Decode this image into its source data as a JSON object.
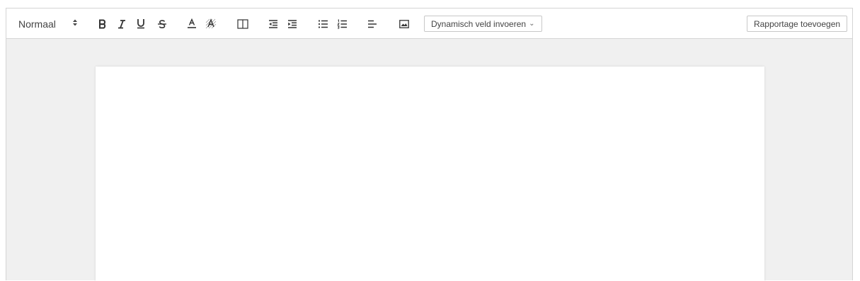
{
  "toolbar": {
    "style_select": {
      "value": "Normaal",
      "caret_icon": "up-down-caret-icon"
    },
    "buttons": [
      "bold-icon",
      "italic-icon",
      "underline-icon",
      "strikethrough-icon",
      "font-color-icon",
      "background-color-icon",
      "table-columns-icon",
      "outdent-icon",
      "indent-icon",
      "bullet-list-icon",
      "ordered-list-icon",
      "align-left-icon",
      "image-icon"
    ],
    "dynamic_field": {
      "label": "Dynamisch veld invoeren",
      "chevron": "⌄"
    },
    "add_report_label": "Rapportage toevoegen"
  },
  "colors": {
    "toolbar_bg": "#ffffff",
    "editor_bg": "#f0f0f0",
    "page_bg": "#ffffff",
    "icon": "#444444",
    "border": "#d4d4d4"
  }
}
